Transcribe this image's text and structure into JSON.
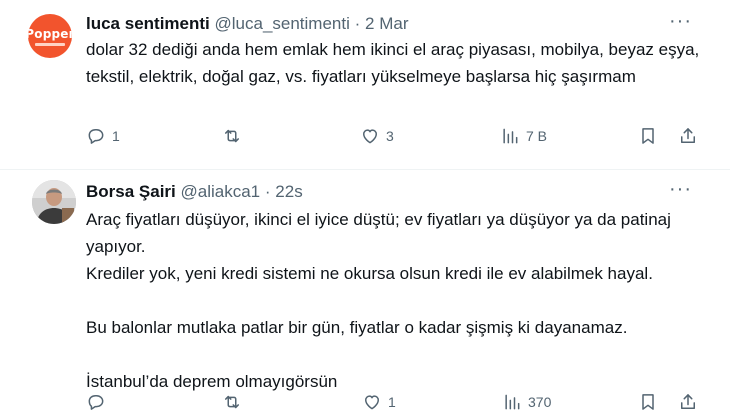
{
  "tweets": [
    {
      "name": "luca sentimenti",
      "handle": "@luca_sentimenti",
      "sep": "·",
      "time": "2 Mar",
      "avatar_text": "Popper",
      "text": "dolar 32 dediği anda hem emlak hem ikinci el araç piyasası, mobilya, beyaz eşya, tekstil, elektrik, doğal gaz, vs.  fiyatları yükselmeye başlarsa hiç şaşırmam",
      "replies": "1",
      "reposts": "",
      "likes": "3",
      "views": "7 B"
    },
    {
      "name": "Borsa Şairi",
      "handle": "@aliakca1",
      "sep": "·",
      "time": "22s",
      "text": "Araç fiyatları düşüyor, ikinci el iyice düştü; ev fiyatları ya düşüyor ya da patinaj yapıyor.\nKrediler yok, yeni kredi sistemi ne okursa olsun kredi ile ev alabilmek hayal.\n\nBu balonlar mutlaka patlar bir gün, fiyatlar o kadar şişmiş ki dayanamaz.\n\nİstanbul’da deprem olmayıgörsün",
      "replies": "",
      "reposts": "",
      "likes": "1",
      "views": "370"
    }
  ],
  "icons": {
    "more": "more-dots-icon",
    "reply": "reply-icon",
    "repost": "repost-icon",
    "like": "heart-icon",
    "views": "views-icon",
    "bookmark": "bookmark-icon",
    "share": "share-icon"
  },
  "colors": {
    "text": "#0f1419",
    "muted": "#536471",
    "avatar_brand": "#f2542d",
    "divider": "#eff3f4"
  }
}
